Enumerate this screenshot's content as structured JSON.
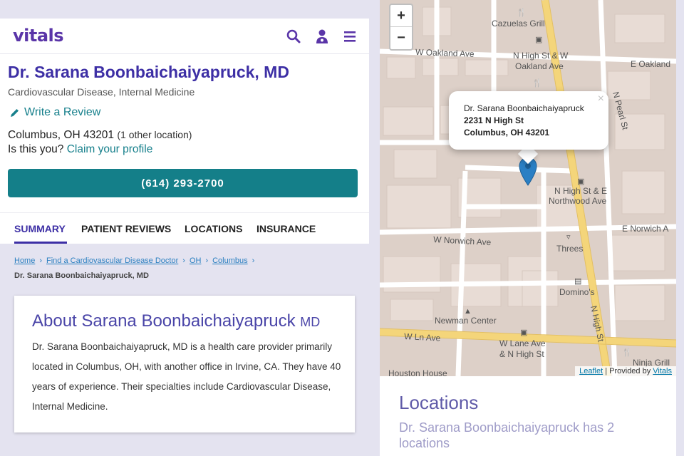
{
  "header": {
    "logo": "vitals",
    "icons": [
      "search-icon",
      "doctor-icon",
      "menu-icon"
    ],
    "brand_color": "#5a35a8"
  },
  "profile": {
    "name": "Dr. Sarana Boonbaichaiyapruck, MD",
    "specialties": "Cardiovascular Disease, Internal Medicine",
    "write_review": "Write a Review",
    "location": "Columbus, OH 43201",
    "other_locations": "(1 other location)",
    "claim_prefix": "Is this you?",
    "claim_link": "Claim your profile",
    "phone": "(614) 293-2700",
    "accent_color": "#147f89"
  },
  "tabs": [
    "SUMMARY",
    "PATIENT REVIEWS",
    "LOCATIONS",
    "INSURANCE"
  ],
  "breadcrumb": {
    "items": [
      "Home",
      "Find a Cardiovascular Disease Doctor",
      "OH",
      "Columbus"
    ],
    "current": "Dr. Sarana Boonbaichaiyapruck, MD"
  },
  "about": {
    "title": "About Sarana Boonbaichaiyapruck",
    "title_suffix": "MD",
    "body": "Dr. Sarana Boonbaichaiyapruck, MD is a health care provider primarily located in Columbus, OH, with another office in Irvine, CA. They have 40 years of experience. Their specialties include Cardiovascular Disease, Internal Medicine."
  },
  "map": {
    "zoom_in": "+",
    "zoom_out": "−",
    "popup": {
      "name": "Dr. Sarana Boonbaichaiyapruck",
      "street": "2231 N High St",
      "city": "Columbus, OH 43201",
      "close": "×"
    },
    "labels": {
      "cazuelas": "Cazuelas Grill",
      "w_oakland": "W Oakland Ave",
      "n_high_w_oakland_1": "N High St & W",
      "n_high_w_oakland_2": "Oakland Ave",
      "e_oakland": "E Oakland",
      "n_high_e_northwood_1": "N High St & E",
      "n_high_e_northwood_2": "Northwood Ave",
      "w_norwich": "W Norwich Ave",
      "e_norwich": "E Norwich A",
      "threes": "Threes",
      "dominos": "Domino's",
      "newman": "Newman Center",
      "w_ln": "W Ln Ave",
      "w_lane_n_high_1": "W Lane Ave",
      "w_lane_n_high_2": "& N High St",
      "ninja": "Ninja Grill",
      "houston": "Houston House",
      "n_pearl": "N Pearl St",
      "n_high": "N High St"
    },
    "attribution_link": "Leaflet",
    "attribution_text": "| Provided by",
    "attribution_vitals": "Vitals"
  },
  "locations": {
    "title": "Locations",
    "subtitle": "Dr. Sarana Boonbaichaiyapruck has 2 locations"
  }
}
